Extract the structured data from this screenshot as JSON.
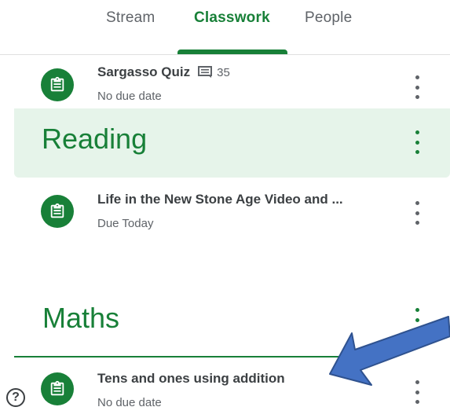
{
  "tabs": [
    {
      "label": "Stream",
      "active": false
    },
    {
      "label": "Classwork",
      "active": true
    },
    {
      "label": "People",
      "active": false
    }
  ],
  "items": [
    {
      "title": "Sargasso Quiz",
      "comments": "35",
      "subtitle": "No due date"
    },
    {
      "title": "Life in the New Stone Age Video and ...",
      "subtitle": "Due Today"
    },
    {
      "title": "Tens and ones using addition",
      "subtitle": "No due date"
    }
  ],
  "topics": [
    {
      "title": "Reading"
    },
    {
      "title": "Maths"
    }
  ],
  "help": {
    "glyph": "?"
  },
  "colors": {
    "accent": "#188038",
    "topic_background": "#e6f4ea",
    "annotation_arrow": "#4472c4"
  },
  "icons": [
    "assignment-icon",
    "comment-icon",
    "more-vert-icon",
    "help-icon",
    "annotation-arrow"
  ]
}
